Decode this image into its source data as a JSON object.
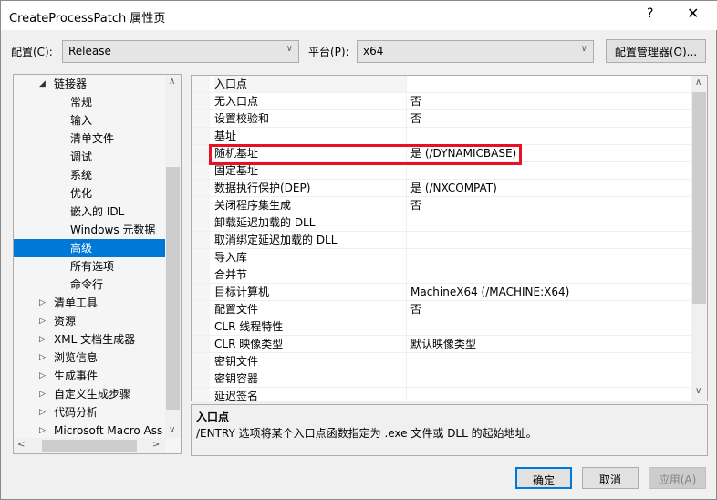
{
  "window": {
    "title": "CreateProcessPatch 属性页",
    "help_icon": "?",
    "close_icon": "✕"
  },
  "toolbar": {
    "config_label": "配置(C):",
    "config_value": "Release",
    "platform_label": "平台(P):",
    "platform_value": "x64",
    "config_manager_label": "配置管理器(O)..."
  },
  "tree": {
    "items": [
      {
        "label": "链接器",
        "level": 1,
        "expanded": true
      },
      {
        "label": "常规",
        "level": 2
      },
      {
        "label": "输入",
        "level": 2
      },
      {
        "label": "清单文件",
        "level": 2
      },
      {
        "label": "调试",
        "level": 2
      },
      {
        "label": "系统",
        "level": 2
      },
      {
        "label": "优化",
        "level": 2
      },
      {
        "label": "嵌入的 IDL",
        "level": 2
      },
      {
        "label": "Windows 元数据",
        "level": 2
      },
      {
        "label": "高级",
        "level": 2,
        "selected": true
      },
      {
        "label": "所有选项",
        "level": 2
      },
      {
        "label": "命令行",
        "level": 2
      },
      {
        "label": "清单工具",
        "level": 1
      },
      {
        "label": "资源",
        "level": 1
      },
      {
        "label": "XML 文档生成器",
        "level": 1
      },
      {
        "label": "浏览信息",
        "level": 1
      },
      {
        "label": "生成事件",
        "level": 1
      },
      {
        "label": "自定义生成步骤",
        "level": 1
      },
      {
        "label": "代码分析",
        "level": 1
      },
      {
        "label": "Microsoft Macro Ass",
        "level": 1
      }
    ]
  },
  "grid": {
    "rows": [
      {
        "name": "入口点",
        "value": ""
      },
      {
        "name": "无入口点",
        "value": "否"
      },
      {
        "name": "设置校验和",
        "value": "否"
      },
      {
        "name": "基址",
        "value": ""
      },
      {
        "name": "随机基址",
        "value": "是 (/DYNAMICBASE)",
        "highlighted": true
      },
      {
        "name": "固定基址",
        "value": ""
      },
      {
        "name": "数据执行保护(DEP)",
        "value": "是 (/NXCOMPAT)"
      },
      {
        "name": "关闭程序集生成",
        "value": "否"
      },
      {
        "name": "卸载延迟加载的 DLL",
        "value": ""
      },
      {
        "name": "取消绑定延迟加载的 DLL",
        "value": ""
      },
      {
        "name": "导入库",
        "value": ""
      },
      {
        "name": "合并节",
        "value": ""
      },
      {
        "name": "目标计算机",
        "value": "MachineX64 (/MACHINE:X64)"
      },
      {
        "name": "配置文件",
        "value": "否"
      },
      {
        "name": "CLR 线程特性",
        "value": ""
      },
      {
        "name": "CLR 映像类型",
        "value": "默认映像类型"
      },
      {
        "name": "密钥文件",
        "value": ""
      },
      {
        "name": "密钥容器",
        "value": ""
      },
      {
        "name": "延迟签名",
        "value": ""
      }
    ]
  },
  "description": {
    "title": "入口点",
    "text": "/ENTRY 选项将某个入口点函数指定为 .exe 文件或 DLL 的起始地址。"
  },
  "buttons": {
    "ok": "确定",
    "cancel": "取消",
    "apply": "应用(A)"
  },
  "colors": {
    "selection": "#0078d7",
    "highlight_box": "#e81123"
  }
}
